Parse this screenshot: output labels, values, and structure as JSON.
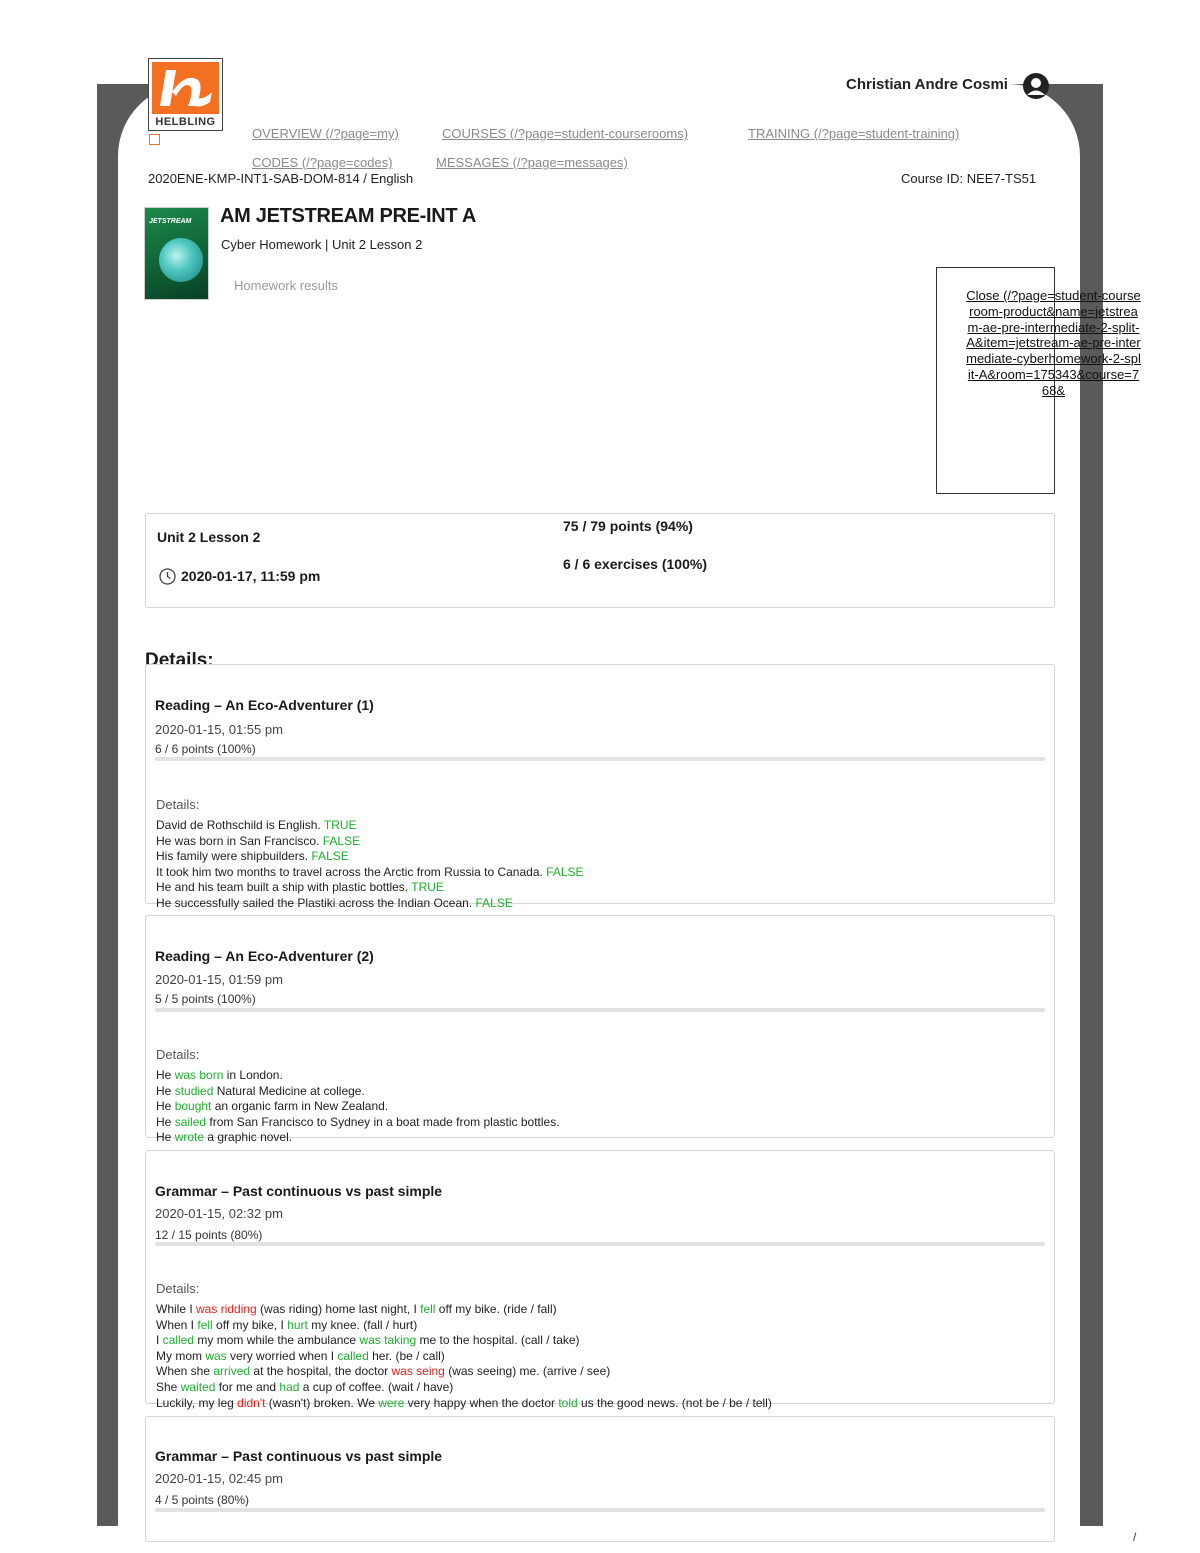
{
  "header": {
    "logo_text": "HELBLING",
    "user_name": "Christian Andre Cosmi",
    "nav": [
      {
        "label": "OVERVIEW (/?page=my)"
      },
      {
        "label": "COURSES (/?page=student-courserooms)"
      },
      {
        "label": "TRAINING (/?page=student-training)"
      },
      {
        "label": "CODES (/?page=codes)"
      },
      {
        "label": "MESSAGES (/?page=messages)"
      }
    ],
    "class_code": "2020ENE-KMP-INT1-SAB-DOM-814 / English",
    "course_id": "Course ID: NEE7-TS51"
  },
  "course": {
    "cover_title": "JETSTREAM",
    "title": "AM JETSTREAM PRE-INT A",
    "subtitle": "Cyber Homework | Unit 2 Lesson 2",
    "results_label": "Homework results",
    "close_link": "Close (/?page=student-courseroom-product&name=jetstream-ae-pre-intermediate-2-split-A&item=jetstream-ae-pre-intermediate-cyberhomework-2-split-A&room=175343&course=768&"
  },
  "summary": {
    "lesson": "Unit 2 Lesson 2",
    "due": "2020-01-17, 11:59 pm",
    "points": "75 / 79 points (94%)",
    "exercises": "6 / 6 exercises (100%)"
  },
  "details_heading": "Details:",
  "exercises": [
    {
      "title": "Reading – An Eco-Adventurer (1)",
      "date": "2020-01-15, 01:55 pm",
      "points": "6 / 6 points (100%)",
      "details_label": "Details:",
      "lines": [
        [
          {
            "t": "David de Rothschild is English. "
          },
          {
            "t": "TRUE",
            "c": "ok"
          }
        ],
        [
          {
            "t": "He was born in San Francisco. "
          },
          {
            "t": "FALSE",
            "c": "ok"
          }
        ],
        [
          {
            "t": "His family were shipbuilders. "
          },
          {
            "t": "FALSE",
            "c": "ok"
          }
        ],
        [
          {
            "t": "It took him two months to travel across the Arctic from Russia to Canada. "
          },
          {
            "t": "FALSE",
            "c": "ok"
          }
        ],
        [
          {
            "t": "He and his team built a ship with plastic bottles. "
          },
          {
            "t": "TRUE",
            "c": "ok"
          }
        ],
        [
          {
            "t": "He successfully sailed the Plastiki across the Indian Ocean. "
          },
          {
            "t": "FALSE",
            "c": "ok"
          }
        ]
      ]
    },
    {
      "title": "Reading – An Eco-Adventurer (2)",
      "date": "2020-01-15, 01:59 pm",
      "points": "5 / 5 points (100%)",
      "details_label": "Details:",
      "lines": [
        [
          {
            "t": "He "
          },
          {
            "t": "was born",
            "c": "ok"
          },
          {
            "t": " in London."
          }
        ],
        [
          {
            "t": "He "
          },
          {
            "t": "studied",
            "c": "ok"
          },
          {
            "t": " Natural Medicine at college."
          }
        ],
        [
          {
            "t": "He "
          },
          {
            "t": "bought",
            "c": "ok"
          },
          {
            "t": " an organic farm in New Zealand."
          }
        ],
        [
          {
            "t": "He "
          },
          {
            "t": "sailed",
            "c": "ok"
          },
          {
            "t": " from San Francisco to Sydney in a boat made from plastic bottles."
          }
        ],
        [
          {
            "t": "He "
          },
          {
            "t": "wrote",
            "c": "ok"
          },
          {
            "t": " a graphic novel."
          }
        ]
      ]
    },
    {
      "title": "Grammar – Past continuous vs past simple",
      "date": "2020-01-15, 02:32 pm",
      "points": "12 / 15 points (80%)",
      "details_label": "Details:",
      "lines": [
        [
          {
            "t": "While I "
          },
          {
            "t": "was ridding",
            "c": "bad"
          },
          {
            "t": " (was riding) home last night, I "
          },
          {
            "t": "fell",
            "c": "ok"
          },
          {
            "t": " off my bike. (ride / fall)"
          }
        ],
        [
          {
            "t": "When I "
          },
          {
            "t": "fell",
            "c": "ok"
          },
          {
            "t": " off my bike, I "
          },
          {
            "t": "hurt",
            "c": "ok"
          },
          {
            "t": " my knee. (fall / hurt)"
          }
        ],
        [
          {
            "t": "I "
          },
          {
            "t": "called",
            "c": "ok"
          },
          {
            "t": " my mom while the ambulance "
          },
          {
            "t": "was taking",
            "c": "ok"
          },
          {
            "t": " me to the hospital. (call / take)"
          }
        ],
        [
          {
            "t": "My mom "
          },
          {
            "t": "was",
            "c": "ok"
          },
          {
            "t": " very worried when I "
          },
          {
            "t": "called",
            "c": "ok"
          },
          {
            "t": " her. (be / call)"
          }
        ],
        [
          {
            "t": "When she "
          },
          {
            "t": "arrived",
            "c": "ok"
          },
          {
            "t": " at the hospital, the doctor "
          },
          {
            "t": "was seing",
            "c": "bad"
          },
          {
            "t": " (was seeing) me. (arrive / see)"
          }
        ],
        [
          {
            "t": "She "
          },
          {
            "t": "waited",
            "c": "ok"
          },
          {
            "t": " for me and "
          },
          {
            "t": "had",
            "c": "ok"
          },
          {
            "t": " a cup of coffee. (wait / have)"
          }
        ],
        [
          {
            "t": "Luckily, my leg "
          },
          {
            "t": "didn't",
            "c": "bad"
          },
          {
            "t": " (wasn't) broken. We "
          },
          {
            "t": "were",
            "c": "ok"
          },
          {
            "t": " very happy when the doctor "
          },
          {
            "t": "told",
            "c": "ok"
          },
          {
            "t": " us the good news. (not be / be / tell)"
          }
        ]
      ]
    },
    {
      "title": "Grammar – Past continuous vs past simple",
      "date": "2020-01-15, 02:45 pm",
      "points": "4 / 5 points (80%)",
      "details_label": "",
      "lines": []
    }
  ],
  "page_mark": "/",
  "colors": {
    "frame": "#5a5a5a",
    "brand": "#f36f21",
    "correct": "#1fae2e",
    "wrong": "#e0231c"
  }
}
